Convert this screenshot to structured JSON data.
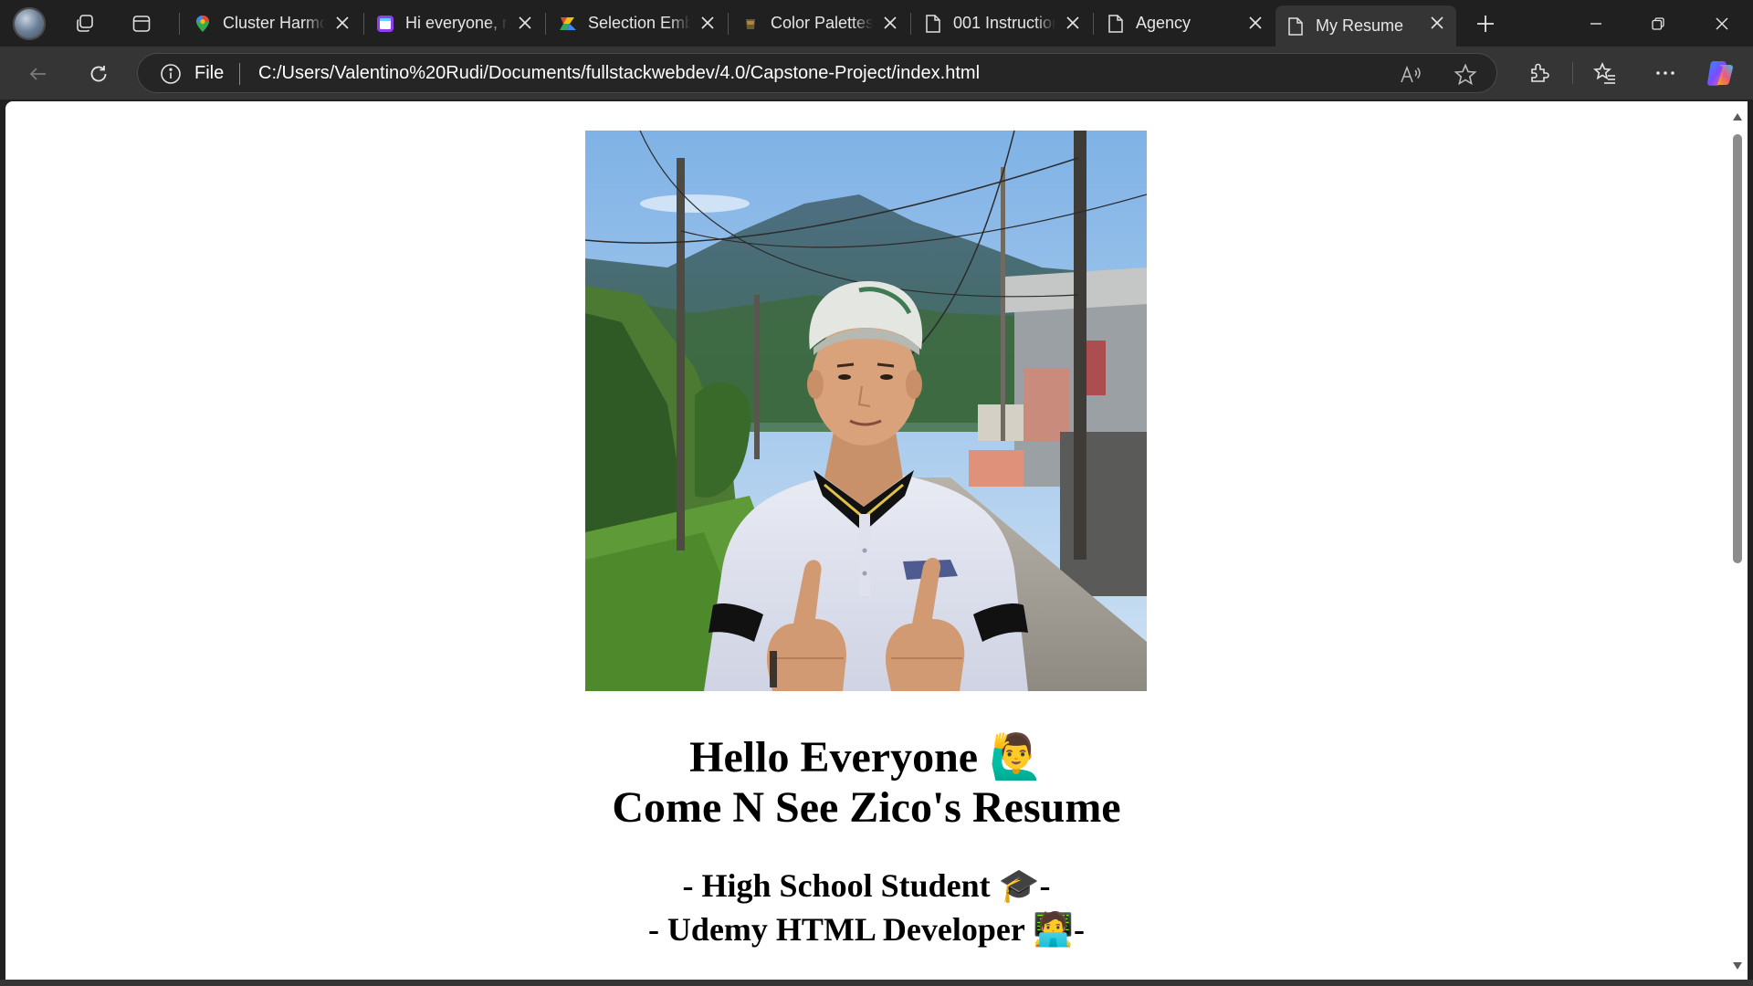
{
  "browser": {
    "tabs": [
      {
        "label": "Cluster Harmonic",
        "icon": "maps-pin-icon",
        "active": false
      },
      {
        "label": "Hi everyone, my",
        "icon": "calendar-app-icon",
        "active": false
      },
      {
        "label": "Selection Embed",
        "icon": "google-slides-icon",
        "active": false
      },
      {
        "label": "Color Palettes",
        "icon": "palette-icon",
        "active": false
      },
      {
        "label": "001 Instructions",
        "icon": "document-icon",
        "active": false
      },
      {
        "label": "Agency",
        "icon": "document-icon",
        "active": false
      },
      {
        "label": "My Resume",
        "icon": "document-icon",
        "active": true
      }
    ],
    "address": {
      "scheme_label": "File",
      "url": "C:/Users/Valentino%20Rudi/Documents/fullstackwebdev/4.0/Capstone-Project/index.html"
    }
  },
  "page": {
    "heading_line1": "Hello Everyone",
    "heading_line1_emoji": "🙋‍♂️",
    "heading_line2": "Come N See Zico's Resume",
    "subtitle_line1_prefix": "- High School Student",
    "subtitle_line1_emoji": "🎓",
    "subtitle_line1_suffix": "-",
    "subtitle_line2_prefix": "- Udemy HTML Developer",
    "subtitle_line2_emoji": "🧑‍💻",
    "subtitle_line2_suffix": "-"
  },
  "colors": {
    "chrome_bg": "#202020",
    "toolbar_bg": "#353535",
    "page_bg": "#ffffff",
    "text": "#000000"
  }
}
